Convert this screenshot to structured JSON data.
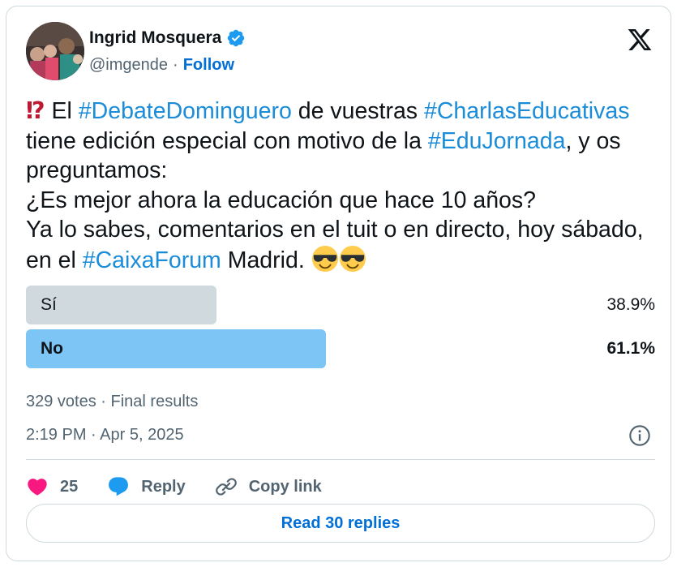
{
  "author": {
    "name": "Ingrid Mosquera",
    "handle": "@imgende",
    "separator": "·",
    "follow_label": "Follow"
  },
  "tweet": {
    "lead_emoji": "⁉",
    "t1": " El ",
    "tag1": "#DebateDominguero",
    "t2": " de vuestras ",
    "tag2": "#CharlasEducativas",
    "t3": " tiene edición especial con motivo de la ",
    "tag3": "#EduJornada",
    "t4": ", y os preguntamos:\n¿Es mejor ahora la educación que hace 10 años?\nYa lo sabes, comentarios en el tuit o en directo, hoy sábado, en el ",
    "tag4": "#CaixaForum",
    "t5": " Madrid. "
  },
  "poll": {
    "options": [
      {
        "label": "Sí",
        "percent_text": "38.9%",
        "fraction": 0.389
      },
      {
        "label": "No",
        "percent_text": "61.1%",
        "fraction": 0.611
      }
    ],
    "meta": "329 votes · Final results"
  },
  "timestamp": "2:19 PM · Apr 5, 2025",
  "actions": {
    "like_count": "25",
    "reply_label": "Reply",
    "copy_label": "Copy link"
  },
  "read_replies_label": "Read 30 replies",
  "colors": {
    "accent": "#1d9bf0",
    "poll_winner": "#7cc5f5",
    "poll_other": "#cfd9de",
    "like": "#f91880"
  },
  "icons": [
    "verified-badge-icon",
    "x-logo-icon",
    "sunglasses-emoji-icon",
    "info-icon",
    "heart-icon",
    "reply-bubble-icon",
    "link-icon"
  ]
}
